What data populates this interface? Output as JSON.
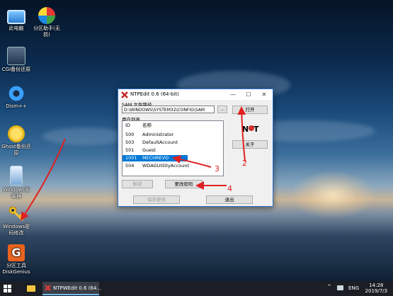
{
  "desktop_icons": [
    {
      "label": "此电脑",
      "icon": "computer-icon"
    },
    {
      "label": "分区助手(无损)",
      "icon": "partition-assistant-icon"
    },
    {
      "label": "CGI备份还原",
      "icon": "cgi-backup-icon"
    },
    {
      "label": "Dism++",
      "icon": "dism-gear-icon"
    },
    {
      "label": "Ghost备份还原",
      "icon": "ghost-backup-icon"
    },
    {
      "label": "Windows安装器",
      "icon": "windows-installer-icon"
    },
    {
      "label": "Windows密码修改",
      "icon": "key-icon"
    },
    {
      "label": "分区工具DiskGenius",
      "icon": "diskgenius-icon"
    }
  ],
  "window": {
    "title": "NTPEdit 0.6 (64-bit)",
    "sam_label": "SAM 文件路径",
    "sam_path": "D:\\WINDOWS\\SYSTEM32\\CONFIG\\SAM",
    "browse_label": "...",
    "open_label": "打开",
    "about_label": "关于",
    "user_list_label": "用户列表",
    "columns": {
      "id": "ID",
      "name": "名称"
    },
    "users": [
      {
        "id": "500",
        "name": "Administrator",
        "selected": false
      },
      {
        "id": "503",
        "name": "DefaultAccount",
        "selected": false
      },
      {
        "id": "501",
        "name": "Guest",
        "selected": false
      },
      {
        "id": "1001",
        "name": "MECHREVO",
        "selected": true
      },
      {
        "id": "504",
        "name": "WDAGUtilityAccount",
        "selected": false
      }
    ],
    "unlock_label": "解锁",
    "change_password_label": "更改密码",
    "save_label": "保存更改",
    "exit_label": "退出",
    "controls": {
      "minimize": "—",
      "maximize": "☐",
      "close": "✕"
    }
  },
  "annotations": [
    "2",
    "3",
    "4"
  ],
  "taskbar": {
    "app_label": "NTPWEdit 0.6 (64...",
    "language": "ENG",
    "time": "14:28",
    "date": "2019/7/3"
  },
  "colors": {
    "selection": "#0078d7",
    "annotation": "#e02020",
    "window_border": "#2b70c8"
  }
}
